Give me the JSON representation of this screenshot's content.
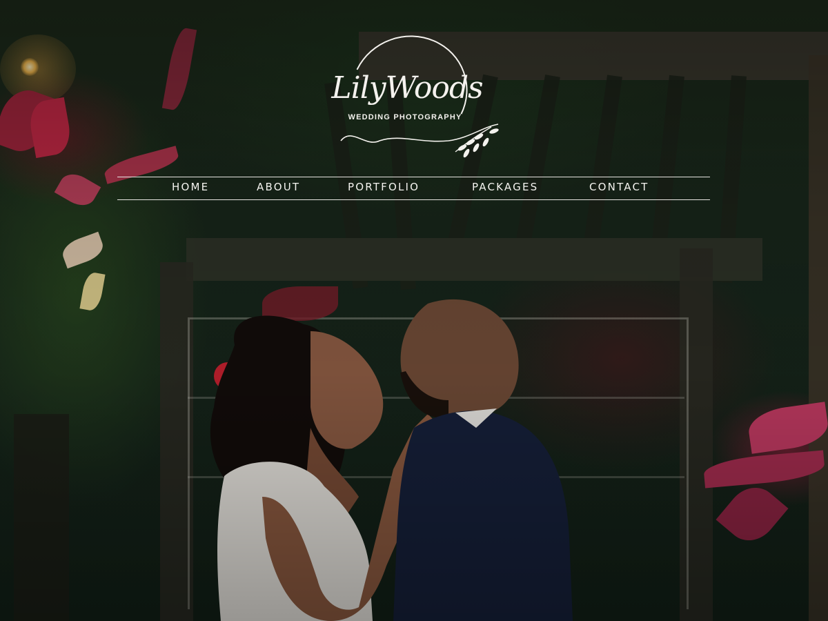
{
  "logo": {
    "name": "LilyWoods",
    "tagline": "WEDDING PHOTOGRAPHY"
  },
  "nav": {
    "items": [
      {
        "label": "HOME"
      },
      {
        "label": "ABOUT"
      },
      {
        "label": "PORTFOLIO"
      },
      {
        "label": "PACKAGES"
      },
      {
        "label": "CONTACT"
      }
    ]
  },
  "colors": {
    "nav_text": "#f5f4f0",
    "overlay": "#101a10"
  }
}
